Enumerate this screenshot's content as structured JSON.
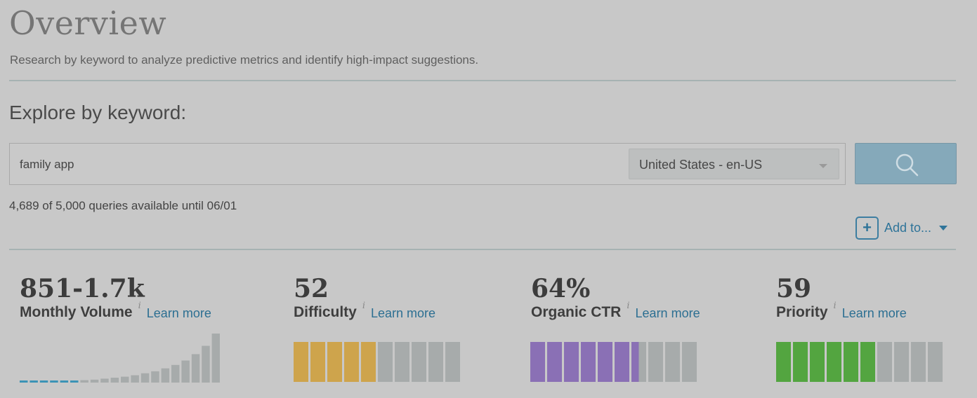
{
  "header": {
    "title": "Overview",
    "subtitle": "Research by keyword to analyze predictive metrics and identify high-impact suggestions."
  },
  "explore": {
    "heading": "Explore by keyword:",
    "search_value": "family app",
    "locale": "United States - en-US",
    "queries_note": "4,689 of 5,000 queries available until 06/01"
  },
  "actions": {
    "add_to_label": "Add to..."
  },
  "metrics": [
    {
      "value": "851-1.7k",
      "label": "Monthly Volume",
      "learn_more": "Learn more",
      "volume_trend": [
        0.02,
        0.02,
        0.02,
        0.02,
        0.02,
        0.04,
        0.05,
        0.06,
        0.08,
        0.1,
        0.12,
        0.15,
        0.19,
        0.23,
        0.29,
        0.36,
        0.45,
        0.58,
        0.75,
        1.0
      ],
      "highlighted_bars": 6
    },
    {
      "value": "52",
      "label": "Difficulty",
      "learn_more": "Learn more",
      "segments_filled": 5,
      "segments_total": 10,
      "color": "#cea44c"
    },
    {
      "value": "64%",
      "label": "Organic CTR",
      "learn_more": "Learn more",
      "segments_filled": 6.5,
      "segments_total": 10,
      "color": "#8a70b5"
    },
    {
      "value": "59",
      "label": "Priority",
      "learn_more": "Learn more",
      "segments_filled": 6,
      "segments_total": 10,
      "color": "#53a540"
    }
  ],
  "colors": {
    "accent": "#2c6f92",
    "search_button": "#85a9ba",
    "volume_highlight": "#3c93b6",
    "bar_empty": "#a7abab"
  },
  "icons": {
    "search": "search-icon",
    "add": "plus-icon",
    "dropdown": "chevron-down-icon",
    "info": "info-icon"
  }
}
